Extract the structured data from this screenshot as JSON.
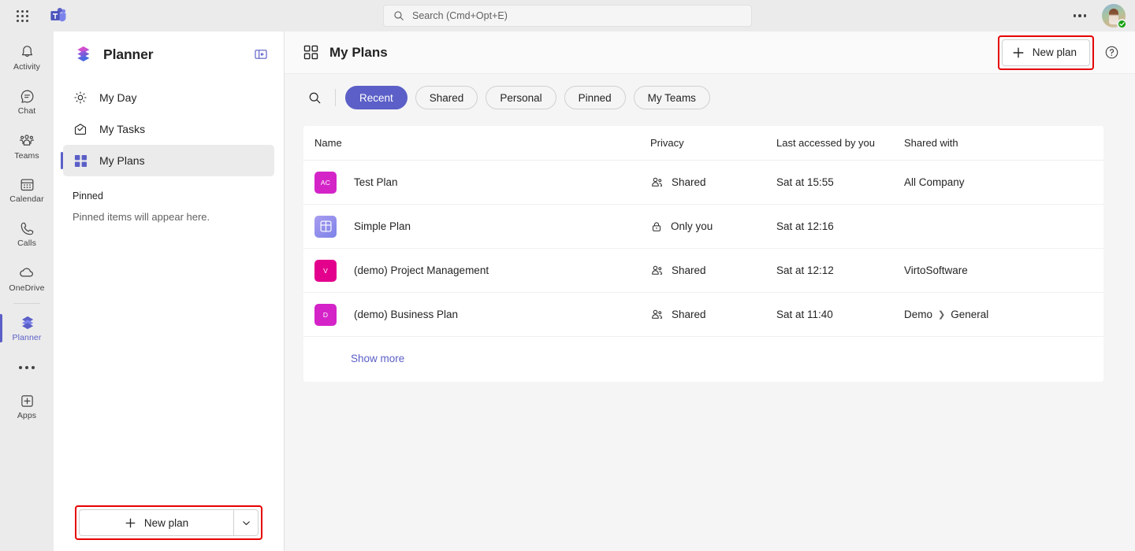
{
  "titlebar": {
    "app_launcher_icon": "waffle-grid-icon",
    "teams_logo_icon": "microsoft-teams-logo",
    "search": {
      "placeholder": "Search (Cmd+Opt+E)",
      "value": "",
      "icon": "search-icon"
    },
    "more_icon": "ellipsis-icon",
    "avatar": {
      "name": "user-avatar",
      "presence": "Available"
    }
  },
  "rail": {
    "items": [
      {
        "label": "Activity",
        "icon": "bell-icon",
        "active": false
      },
      {
        "label": "Chat",
        "icon": "chat-bubble-icon",
        "active": false
      },
      {
        "label": "Teams",
        "icon": "people-team-icon",
        "active": false
      },
      {
        "label": "Calendar",
        "icon": "calendar-icon",
        "active": false
      },
      {
        "label": "Calls",
        "icon": "phone-icon",
        "active": false
      },
      {
        "label": "OneDrive",
        "icon": "cloud-icon",
        "active": false
      },
      {
        "label": "Planner",
        "icon": "planner-icon",
        "active": true
      }
    ],
    "more_icon": "ellipsis-icon",
    "apps": {
      "label": "Apps",
      "icon": "apps-plus-icon"
    }
  },
  "sidebar": {
    "title": "Planner",
    "logo_icon": "planner-logo",
    "collapse_icon": "collapse-panel-icon",
    "items": [
      {
        "label": "My Day",
        "icon": "sun-icon",
        "active": false
      },
      {
        "label": "My Tasks",
        "icon": "tasks-checkmark-icon",
        "active": false
      },
      {
        "label": "My Plans",
        "icon": "grid-squares-icon",
        "active": true
      }
    ],
    "pinned_heading": "Pinned",
    "pinned_empty": "Pinned items will appear here.",
    "new_plan": {
      "label": "New plan",
      "plus_icon": "plus-icon",
      "caret_icon": "chevron-down-icon",
      "highlighted": true
    }
  },
  "main": {
    "header": {
      "title": "My Plans",
      "icon": "grid-squares-icon"
    },
    "new_plan_button": {
      "label": "New plan",
      "icon": "plus-icon",
      "highlighted": true
    },
    "help_icon": "help-question-icon",
    "filter": {
      "search_icon": "search-icon",
      "chips": [
        {
          "label": "Recent",
          "selected": true
        },
        {
          "label": "Shared",
          "selected": false
        },
        {
          "label": "Personal",
          "selected": false
        },
        {
          "label": "Pinned",
          "selected": false
        },
        {
          "label": "My Teams",
          "selected": false
        }
      ]
    },
    "table": {
      "columns": [
        "Name",
        "Privacy",
        "Last accessed by you",
        "Shared with"
      ],
      "rows": [
        {
          "name": "Test Plan",
          "tile_text": "AC",
          "tile_color": "#d424c8",
          "tile_glyph": "text",
          "privacy": "Shared",
          "privacy_icon": "people-icon",
          "last_accessed": "Sat at 15:55",
          "shared_with": "All Company",
          "shared_with_parent": "",
          "shared_with_child": ""
        },
        {
          "name": "Simple Plan",
          "tile_text": "",
          "tile_color": "#8b7fe0",
          "tile_glyph": "board",
          "privacy": "Only you",
          "privacy_icon": "lock-icon",
          "last_accessed": "Sat at 12:16",
          "shared_with": "",
          "shared_with_parent": "",
          "shared_with_child": ""
        },
        {
          "name": "(demo) Project Management",
          "tile_text": "V",
          "tile_color": "#e3008c",
          "tile_glyph": "text",
          "privacy": "Shared",
          "privacy_icon": "people-icon",
          "last_accessed": "Sat at 12:12",
          "shared_with": "VirtoSoftware",
          "shared_with_parent": "",
          "shared_with_child": ""
        },
        {
          "name": "(demo) Business Plan",
          "tile_text": "D",
          "tile_color": "#d424c8",
          "tile_glyph": "text",
          "privacy": "Shared",
          "privacy_icon": "people-icon",
          "last_accessed": "Sat at 11:40",
          "shared_with": "",
          "shared_with_parent": "Demo",
          "shared_with_child": "General"
        }
      ],
      "show_more": "Show more"
    }
  },
  "colors": {
    "accent": "#5b5fc7",
    "annotation": "#e60000",
    "presence_available": "#13a10e",
    "rail_bg": "#ebebeb",
    "main_bg": "#f5f5f5"
  }
}
